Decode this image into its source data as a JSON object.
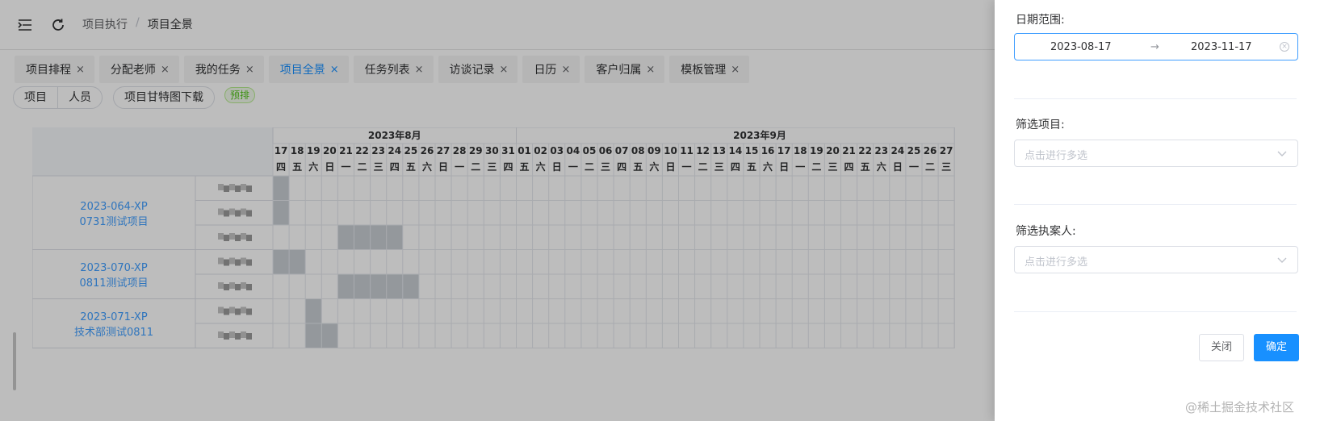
{
  "breadcrumb": [
    "项目执行",
    "项目全景"
  ],
  "tabs": [
    {
      "label": "项目排程",
      "active": false
    },
    {
      "label": "分配老师",
      "active": false
    },
    {
      "label": "我的任务",
      "active": false
    },
    {
      "label": "项目全景",
      "active": true
    },
    {
      "label": "任务列表",
      "active": false
    },
    {
      "label": "访谈记录",
      "active": false
    },
    {
      "label": "日历",
      "active": false
    },
    {
      "label": "客户归属",
      "active": false
    },
    {
      "label": "模板管理",
      "active": false
    }
  ],
  "toolbar": {
    "view_project": "项目",
    "view_person": "人员",
    "gantt_download": "项目甘特图下载",
    "pre_tag": "预排"
  },
  "gantt": {
    "months": [
      {
        "label": "2023年8月",
        "days": 15
      },
      {
        "label": "2023年9月",
        "days": 30
      }
    ],
    "days": [
      "17",
      "18",
      "19",
      "20",
      "21",
      "22",
      "23",
      "24",
      "25",
      "26",
      "27",
      "28",
      "29",
      "30",
      "31",
      "01",
      "02",
      "03",
      "04",
      "05",
      "06",
      "07",
      "08",
      "09",
      "10",
      "11",
      "12",
      "13",
      "14",
      "15",
      "16",
      "17",
      "18",
      "19",
      "20",
      "21",
      "22",
      "23",
      "24",
      "25",
      "26",
      "27"
    ],
    "weekdays": [
      "四",
      "五",
      "六",
      "日",
      "一",
      "二",
      "三",
      "四",
      "五",
      "六",
      "日",
      "一",
      "二",
      "三",
      "四",
      "五",
      "六",
      "日",
      "一",
      "二",
      "三",
      "四",
      "五",
      "六",
      "日",
      "一",
      "二",
      "三",
      "四",
      "五",
      "六",
      "日",
      "一",
      "二",
      "三",
      "四",
      "五",
      "六",
      "日",
      "一",
      "二",
      "三"
    ],
    "projects": [
      {
        "code": "2023-064-XP",
        "name": "0731测试项目",
        "rows": [
          [
            0,
            1
          ],
          [
            0,
            1
          ],
          [
            4,
            8
          ]
        ]
      },
      {
        "code": "2023-070-XP",
        "name": "0811测试项目",
        "rows": [
          [
            0,
            2
          ],
          [
            4,
            9
          ]
        ]
      },
      {
        "code": "2023-071-XP",
        "name": "技术部测试0811",
        "rows": [
          [
            2,
            3
          ],
          [
            2,
            4
          ]
        ]
      }
    ]
  },
  "drawer": {
    "date_label": "日期范围:",
    "date_start": "2023-08-17",
    "date_end": "2023-11-17",
    "project_label": "筛选项目:",
    "project_placeholder": "点击进行多选",
    "executor_label": "筛选执案人:",
    "executor_placeholder": "点击进行多选",
    "close_label": "关闭",
    "confirm_label": "确定"
  },
  "watermark": "@稀土掘金技术社区"
}
